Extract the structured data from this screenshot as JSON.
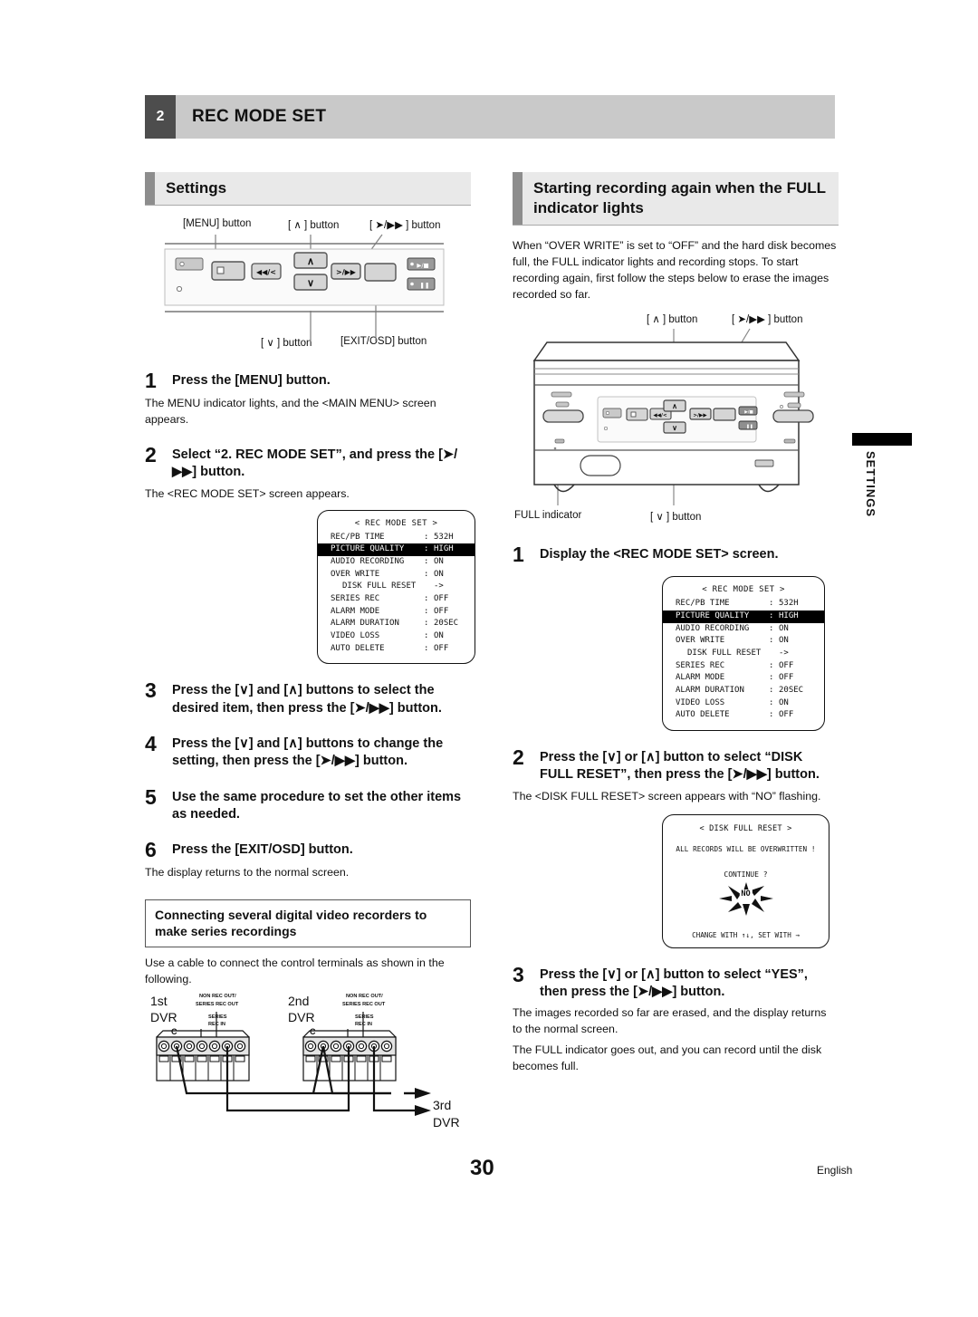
{
  "header": {
    "number": "2",
    "title": "REC MODE SET"
  },
  "side_tab": {
    "label": "SETTINGS"
  },
  "footer": {
    "page_number": "30",
    "language": "English"
  },
  "left": {
    "section_title": "Settings",
    "panel_labels": {
      "menu": "[MENU] button",
      "up": "[ ∧ ] button",
      "play": "[ ➤/▶▶ ] button",
      "down": "[ ∨ ] button",
      "exit": "[EXIT/OSD] button"
    },
    "steps": [
      {
        "num": "1",
        "text": "Press the [MENU] button.",
        "follow": "The MENU indicator lights, and the <MAIN MENU> screen appears."
      },
      {
        "num": "2",
        "text": "Select “2. REC MODE SET”, and press the [➤/▶▶] button.",
        "follow": "The <REC MODE SET> screen appears."
      },
      {
        "num": "3",
        "text": "Press the [∨] and [∧] buttons to select the desired item, then press the [➤/▶▶] button.",
        "follow": ""
      },
      {
        "num": "4",
        "text": "Press the [∨] and [∧] buttons to change the setting, then press the [➤/▶▶] button.",
        "follow": ""
      },
      {
        "num": "5",
        "text": "Use the same procedure to set the other items as needed.",
        "follow": ""
      },
      {
        "num": "6",
        "text": "Press the [EXIT/OSD] button.",
        "follow": "The display returns to the normal screen."
      }
    ],
    "callout": {
      "title": "Connecting several digital video recorders to make series recordings",
      "body": "Use a cable to connect the control terminals as shown in the following."
    },
    "terminal_diagram": {
      "dvr1": "1st\nDVR",
      "dvr1_line1": "1st",
      "dvr1_line2": "DVR",
      "dvr2_line1": "2nd",
      "dvr2_line2": "DVR",
      "dvr3_line1": "3rd",
      "dvr3_line2": "DVR",
      "out_label_line1": "NON REC OUT/",
      "out_label_line2": "SERIES REC OUT",
      "in_label_line1": "SERIES",
      "in_label_line2": "REC IN",
      "common": "C"
    }
  },
  "right": {
    "section_title": "Starting recording again when the FULL indicator lights",
    "intro": "When “OVER WRITE” is set to “OFF” and the hard disk becomes full, the FULL indicator lights and recording stops. To start recording again, first follow the steps below to erase the images recorded so far.",
    "panel_labels": {
      "up": "[ ∧ ] button",
      "play": "[ ➤/▶▶ ] button",
      "full": "FULL indicator",
      "down": "[ ∨ ] button"
    },
    "steps": [
      {
        "num": "1",
        "text": "Display the <REC MODE SET> screen.",
        "follow": ""
      },
      {
        "num": "2",
        "text": "Press the [∨] or [∧] button to select “DISK FULL RESET”, then press the [➤/▶▶] button.",
        "follow": "The <DISK FULL RESET> screen appears with “NO” flashing."
      },
      {
        "num": "3",
        "text": "Press the [∨] or [∧] button to select “YES”, then press the [➤/▶▶] button.",
        "follow": "The images recorded so far are erased, and the display returns to the normal screen.",
        "follow2": "The FULL indicator goes out, and you can record until the disk becomes full."
      }
    ]
  },
  "osd_rec_mode_set": {
    "title": "< REC MODE SET >",
    "rows": [
      {
        "key": "REC/PB TIME",
        "colon": ":",
        "value": "532H",
        "highlight": false,
        "indent": false
      },
      {
        "key": "PICTURE QUALITY",
        "colon": ":",
        "value": "HIGH",
        "highlight": true,
        "indent": false
      },
      {
        "key": "AUDIO RECORDING",
        "colon": ":",
        "value": "ON",
        "highlight": false,
        "indent": false
      },
      {
        "key": "OVER WRITE",
        "colon": ":",
        "value": "ON",
        "highlight": false,
        "indent": false
      },
      {
        "key": "DISK FULL RESET",
        "colon": " ",
        "value": "->",
        "highlight": false,
        "indent": true
      },
      {
        "key": "SERIES REC",
        "colon": ":",
        "value": "OFF",
        "highlight": false,
        "indent": false
      },
      {
        "key": "ALARM MODE",
        "colon": ":",
        "value": "OFF",
        "highlight": false,
        "indent": false
      },
      {
        "key": "ALARM DURATION",
        "colon": ":",
        "value": "20SEC",
        "highlight": false,
        "indent": false
      },
      {
        "key": "VIDEO LOSS",
        "colon": ":",
        "value": "ON",
        "highlight": false,
        "indent": false
      },
      {
        "key": "AUTO DELETE",
        "colon": ":",
        "value": "OFF",
        "highlight": false,
        "indent": false
      }
    ]
  },
  "osd_disk_full_reset": {
    "title": "< DISK FULL RESET >",
    "message": "ALL RECORDS WILL BE OVERWRITTEN !",
    "question": "CONTINUE ?",
    "selection": "NO",
    "footer": "CHANGE WITH ↑↓,  SET WITH →"
  }
}
